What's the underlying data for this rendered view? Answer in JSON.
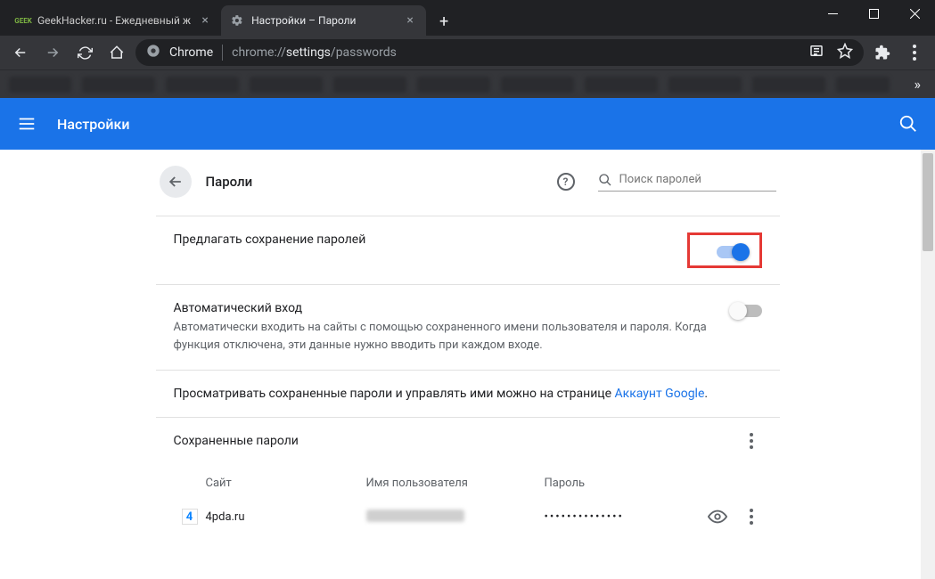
{
  "window": {
    "tabs": [
      {
        "title": "GeekHacker.ru - Ежедневный ж",
        "favicon": "GEEK"
      },
      {
        "title": "Настройки – Пароли",
        "favicon": "gear"
      }
    ],
    "omnibox": {
      "scheme_label": "Chrome",
      "url_prefix": "chrome://",
      "url_mid": "settings",
      "url_suffix": "/passwords"
    }
  },
  "header": {
    "title": "Настройки"
  },
  "page": {
    "title": "Пароли",
    "search_placeholder": "Поиск паролей",
    "offer_save": {
      "label": "Предлагать сохранение паролей",
      "enabled": true
    },
    "auto_signin": {
      "label": "Автоматический вход",
      "desc": "Автоматически входить на сайты с помощью сохраненного имени пользователя и пароля. Когда функция отключена, эти данные нужно вводить при каждом входе.",
      "enabled": false
    },
    "manage_text_prefix": "Просматривать сохраненные пароли и управлять ими можно на странице ",
    "manage_link": "Аккаунт Google",
    "saved_header": "Сохраненные пароли",
    "columns": {
      "site": "Сайт",
      "user": "Имя пользователя",
      "password": "Пароль"
    },
    "entries": [
      {
        "site": "4pda.ru",
        "password_masked": "••••••••••••••"
      }
    ]
  }
}
